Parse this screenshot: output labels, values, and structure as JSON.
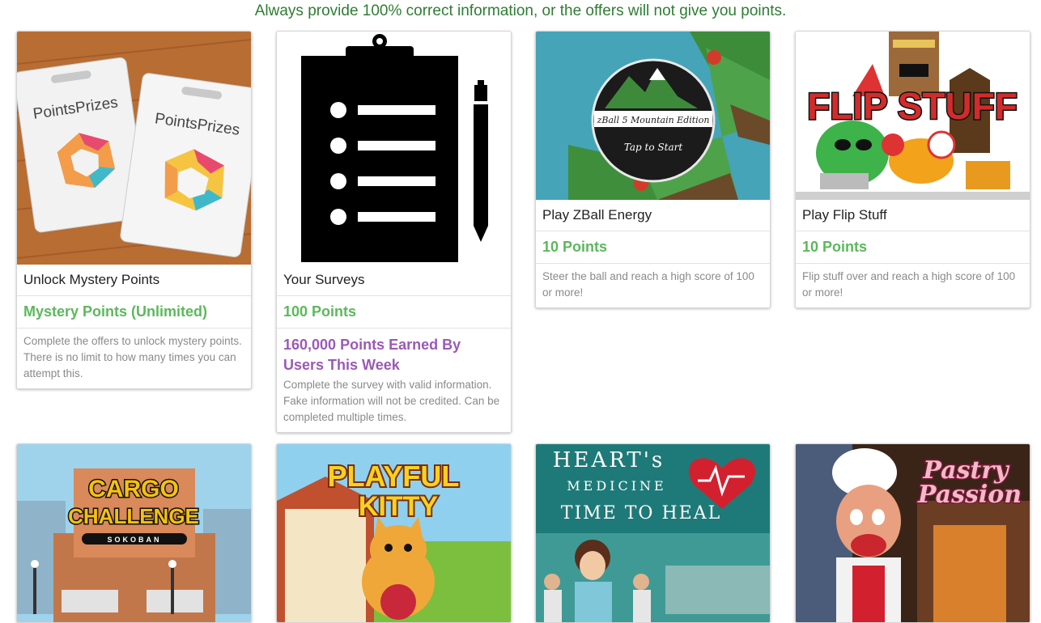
{
  "notice": "Always provide 100% correct information, or the offers will not give you points.",
  "colors": {
    "points_green": "#5cb85c",
    "earned_purple": "#9b59b6",
    "notice_green": "#2e7d32"
  },
  "offers": [
    {
      "title": "Unlock Mystery Points",
      "points": "Mystery Points (Unlimited)",
      "description": "Complete the offers to unlock mystery points. There is no limit to how many times you can attempt this.",
      "image": {
        "card_brand_1": "PointsPrizes",
        "card_brand_2": "PointsPrizes"
      }
    },
    {
      "title": "Your Surveys",
      "points": "100 Points",
      "earned": "160,000 Points Earned By Users This Week",
      "description": "Complete the survey with valid information. Fake information will not be credited. Can be completed multiple times."
    },
    {
      "title": "Play ZBall Energy",
      "points": "10 Points",
      "description": "Steer the ball and reach a high score of 100 or more!",
      "image": {
        "badge_line1": "zBall 5 Mountain Edition",
        "badge_line2": "Tap to Start"
      }
    },
    {
      "title": "Play Flip Stuff",
      "points": "10 Points",
      "description": "Flip stuff over and reach a high score of 100 or more!",
      "image": {
        "logo": "FLIP STUFF"
      }
    }
  ],
  "row2": [
    {
      "logo_line1": "CARGO",
      "logo_line2": "CHALLENGE",
      "logo_line3": "SOKOBAN"
    },
    {
      "logo_line1": "PLAYFUL",
      "logo_line2": "KITTY"
    },
    {
      "logo_line1": "HEART's",
      "logo_line2": "MEDICINE",
      "logo_line3": "TIME TO HEAL"
    },
    {
      "logo_line1": "Pastry",
      "logo_line2": "Passion"
    }
  ]
}
